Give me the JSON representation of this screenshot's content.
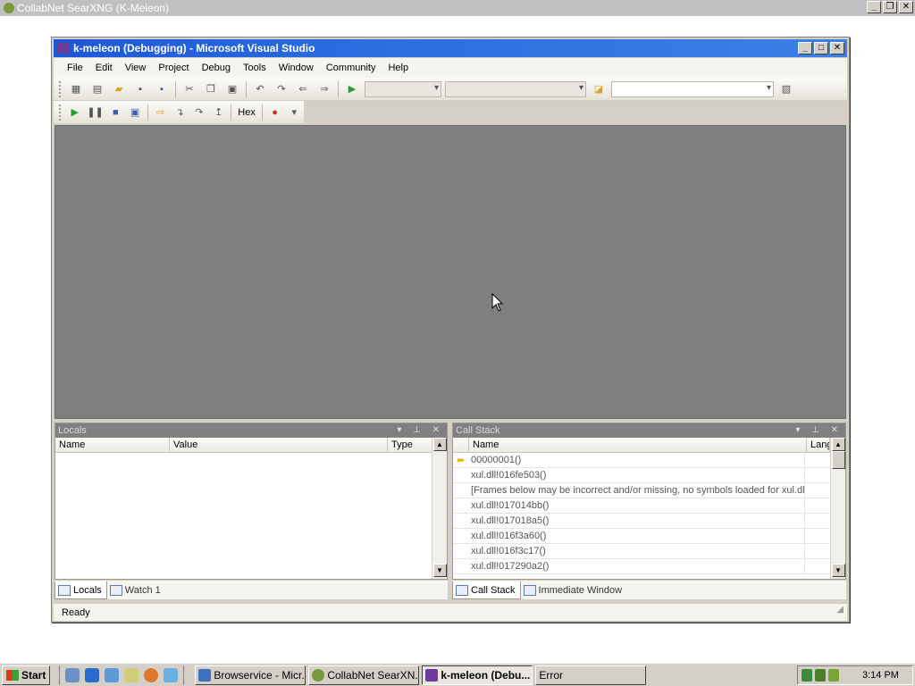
{
  "outer": {
    "title": "CollabNet SearXNG (K-Meleon)"
  },
  "vs": {
    "title": "k-meleon (Debugging) - Microsoft Visual Studio",
    "menu": [
      "File",
      "Edit",
      "View",
      "Project",
      "Debug",
      "Tools",
      "Window",
      "Community",
      "Help"
    ],
    "hex_label": "Hex",
    "status": "Ready"
  },
  "locals": {
    "title": "Locals",
    "columns": [
      "Name",
      "Value",
      "Type"
    ],
    "tabs": [
      "Locals",
      "Watch 1"
    ]
  },
  "callstack": {
    "title": "Call Stack",
    "columns": [
      "Name",
      "Langu"
    ],
    "rows": [
      "00000001()",
      "xul.dll!016fe503()",
      "[Frames below may be incorrect and/or missing, no symbols loaded for xul.dll]",
      "xul.dll!017014bb()",
      "xul.dll!017018a5()",
      "xul.dll!016f3a60()",
      "xul.dll!016f3c17()",
      "xul.dll!017290a2()"
    ],
    "tabs": [
      "Call Stack",
      "Immediate Window"
    ]
  },
  "taskbar": {
    "start": "Start",
    "tasks": [
      "Browservice - Micr...",
      "CollabNet SearXN...",
      "k-meleon (Debu...",
      "Error"
    ],
    "time": "3:14 PM"
  }
}
